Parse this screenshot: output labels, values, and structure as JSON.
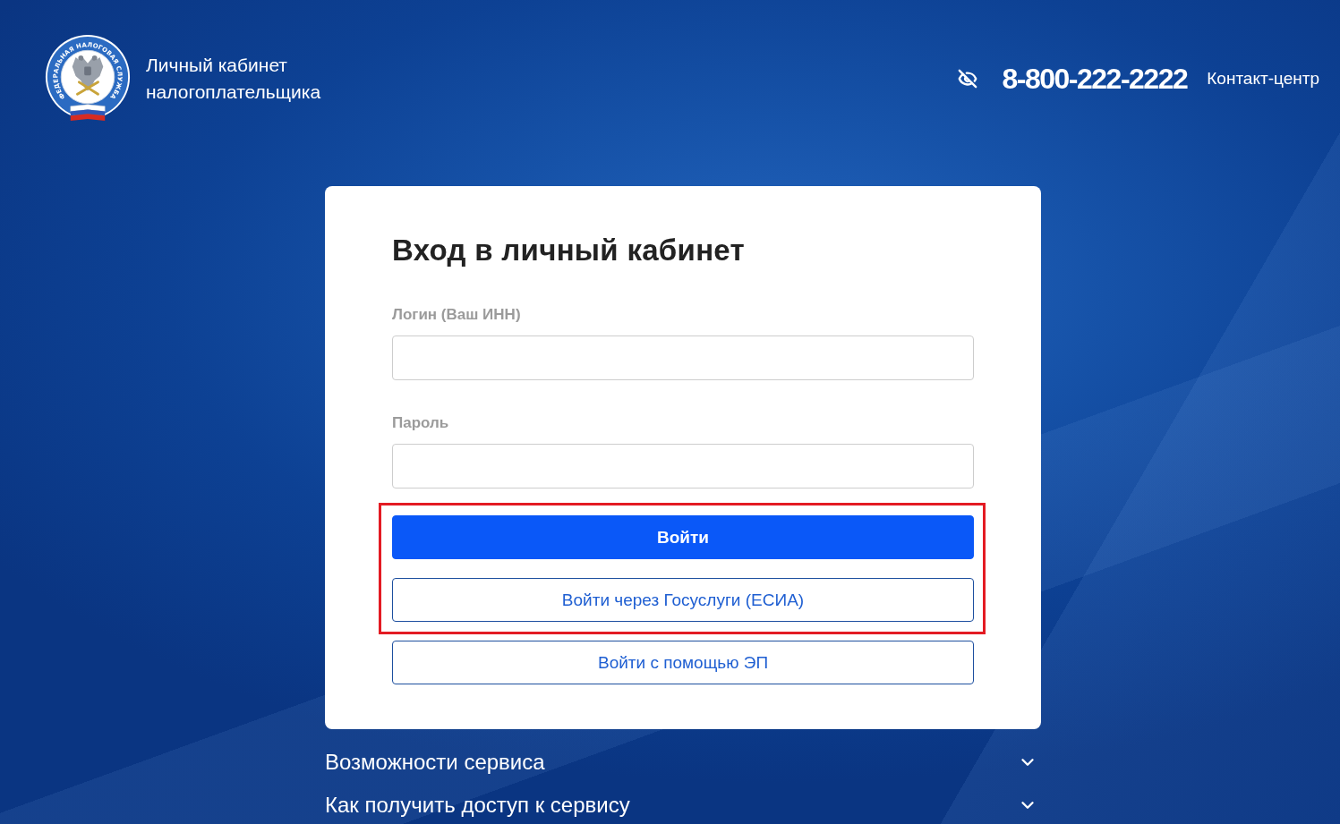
{
  "header": {
    "logo": {
      "ring_text": "ФЕДЕРАЛЬНАЯ НАЛОГОВАЯ СЛУЖБА"
    },
    "title": "Личный кабинет налогоплательщика",
    "phone": "8-800-222-2222",
    "phone_caption": "Контакт-центр"
  },
  "login_card": {
    "title": "Вход в личный кабинет",
    "fields": [
      {
        "label": "Логин (Ваш ИНН)"
      },
      {
        "label": "Пароль"
      }
    ],
    "buttons": [
      {
        "label": "Войти",
        "kind": "primary",
        "highlighted": true
      },
      {
        "label": "Войти через Госуслуги (ЕСИА)",
        "kind": "outline",
        "highlighted": true
      },
      {
        "label": "Войти с помощью ЭП",
        "kind": "outline",
        "highlighted": false
      }
    ]
  },
  "sections": [
    {
      "title": "Возможности сервиса",
      "expanded": false
    },
    {
      "title": "Как получить доступ к сервису",
      "expanded": false
    }
  ]
}
